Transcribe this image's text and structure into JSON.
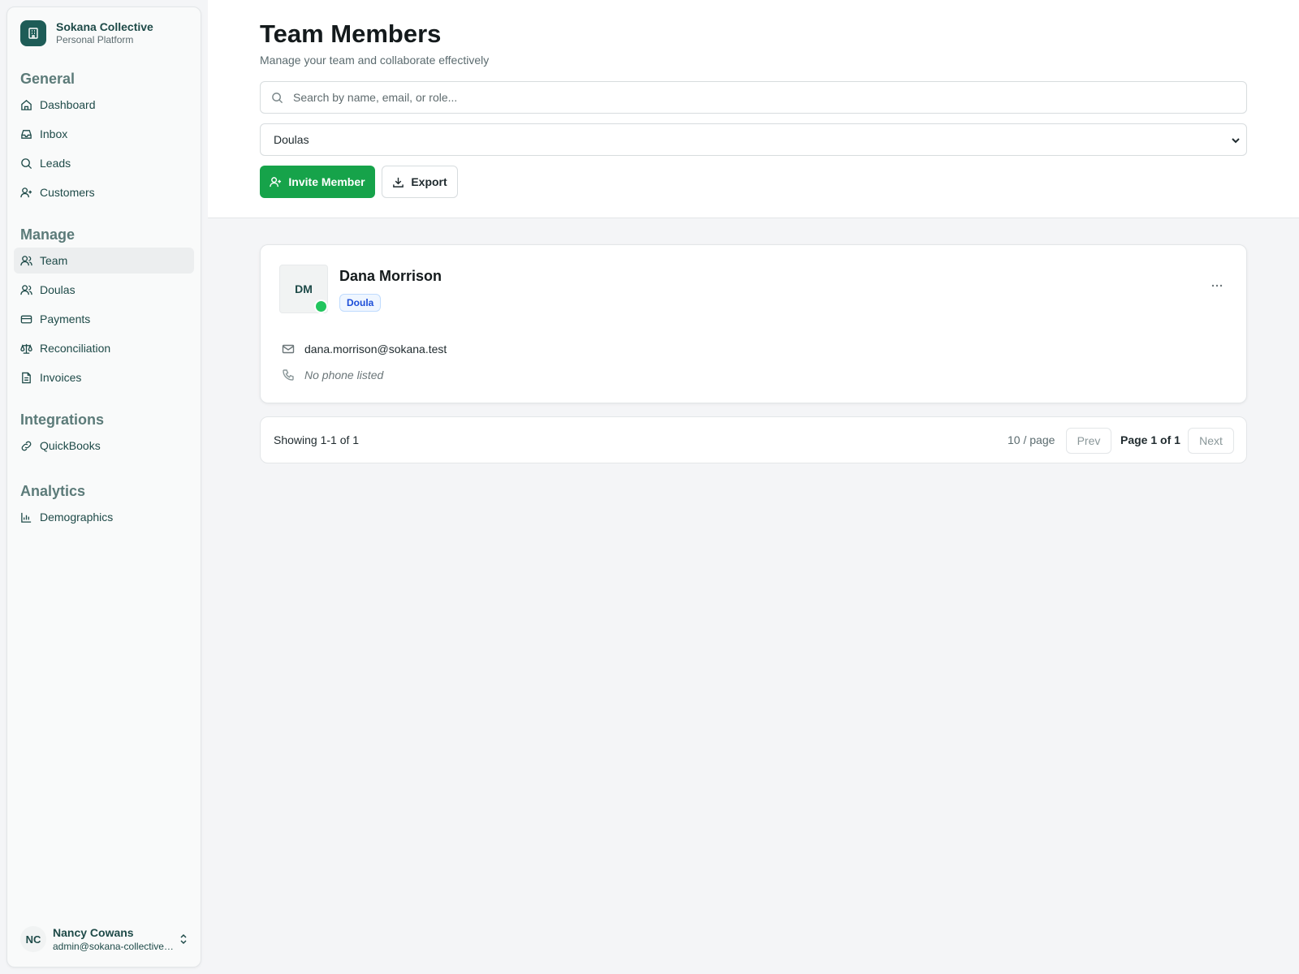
{
  "brand": {
    "name": "Sokana Collective",
    "subtitle": "Personal Platform",
    "icon": "building-icon"
  },
  "sidebar": {
    "groups": [
      {
        "heading": "General",
        "items": [
          {
            "label": "Dashboard",
            "icon": "home-icon"
          },
          {
            "label": "Inbox",
            "icon": "inbox-icon"
          },
          {
            "label": "Leads",
            "icon": "search-icon"
          },
          {
            "label": "Customers",
            "icon": "user-plus-icon"
          }
        ]
      },
      {
        "heading": "Manage",
        "items": [
          {
            "label": "Team",
            "icon": "users-icon",
            "active": true
          },
          {
            "label": "Doulas",
            "icon": "users-icon"
          },
          {
            "label": "Payments",
            "icon": "credit-card-icon"
          },
          {
            "label": "Reconciliation",
            "icon": "scale-icon"
          },
          {
            "label": "Invoices",
            "icon": "file-text-icon"
          }
        ]
      },
      {
        "heading": "Integrations",
        "items": [
          {
            "label": "QuickBooks",
            "icon": "link-icon"
          }
        ]
      },
      {
        "heading": "Analytics",
        "items": [
          {
            "label": "Demographics",
            "icon": "bar-chart-icon"
          }
        ]
      }
    ]
  },
  "user": {
    "initials": "NC",
    "name": "Nancy Cowans",
    "email": "admin@sokana-collective.com"
  },
  "header": {
    "title": "Team Members",
    "subtitle": "Manage your team and collaborate effectively",
    "search_placeholder": "Search by name, email, or role...",
    "filter_value": "Doulas",
    "invite_label": "Invite Member",
    "export_label": "Export"
  },
  "members": [
    {
      "initials": "DM",
      "name": "Dana Morrison",
      "role": "Doula",
      "email": "dana.morrison@sokana.test",
      "phone": "No phone listed",
      "status": "online"
    }
  ],
  "pagination": {
    "showing": "Showing 1-1 of 1",
    "per_page": "10 / page",
    "prev_label": "Prev",
    "page_label": "Page 1 of 1",
    "next_label": "Next"
  },
  "colors": {
    "accent": "#16a34a",
    "brand": "#1e5c57",
    "status_online": "#22c55e",
    "badge_text": "#1d4ed8"
  }
}
